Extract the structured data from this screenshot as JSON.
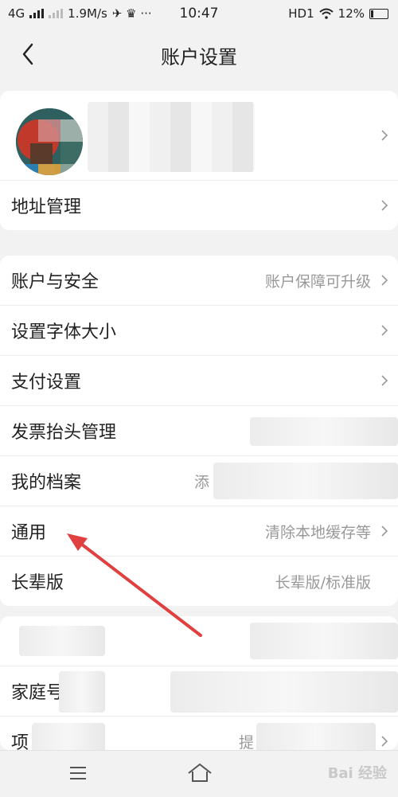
{
  "status_bar": {
    "network": "4G",
    "speed": "1.9M/s",
    "time": "10:47",
    "hd": "HD1",
    "battery": "12%"
  },
  "header": {
    "title": "账户设置"
  },
  "profile": {
    "name": ""
  },
  "section1": {
    "items": [
      {
        "label": "地址管理"
      }
    ]
  },
  "section2": {
    "items": [
      {
        "label": "账户与安全",
        "value": "账户保障可升级"
      },
      {
        "label": "设置字体大小",
        "value": ""
      },
      {
        "label": "支付设置",
        "value": ""
      },
      {
        "label": "发票抬头管理",
        "value": ""
      },
      {
        "label": "我的档案",
        "value": "添"
      },
      {
        "label": "通用",
        "value": "清除本地缓存等"
      },
      {
        "label": "长辈版",
        "value": "长辈版/标准版"
      }
    ]
  },
  "section3": {
    "items": [
      {
        "label": "",
        "value": ""
      },
      {
        "label": "家庭号",
        "value": ""
      },
      {
        "label": "项",
        "value": "提"
      }
    ]
  },
  "watermark": "Bai 经验",
  "colors": {
    "background": "#f2f2f2",
    "card": "#ffffff",
    "annotation": "#e04040"
  }
}
